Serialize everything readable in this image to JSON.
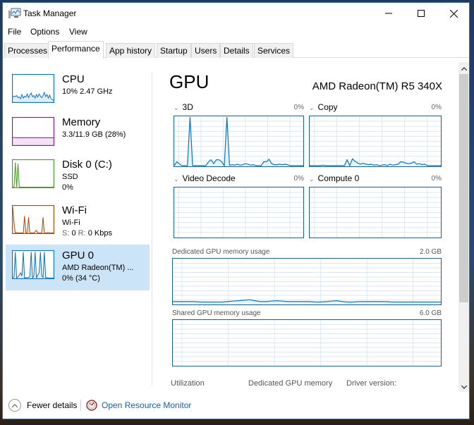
{
  "window": {
    "title": "Task Manager",
    "controls": {
      "minimize": "minimize-icon",
      "maximize": "maximize-icon",
      "close": "close-icon"
    }
  },
  "menu": [
    "File",
    "Options",
    "View"
  ],
  "tabs": [
    {
      "label": "Processes",
      "active": false
    },
    {
      "label": "Performance",
      "active": true
    },
    {
      "label": "App history",
      "active": false
    },
    {
      "label": "Startup",
      "active": false
    },
    {
      "label": "Users",
      "active": false
    },
    {
      "label": "Details",
      "active": false
    },
    {
      "label": "Services",
      "active": false
    }
  ],
  "sidebar": {
    "items": [
      {
        "title": "CPU",
        "line1": "10%  2.47 GHz",
        "line2": "",
        "color": "#1173bb",
        "selected": false,
        "series": [
          18,
          22,
          20,
          24,
          16,
          19,
          12,
          28,
          14,
          22,
          18,
          30,
          16,
          26,
          34,
          20,
          24,
          14,
          28,
          18,
          30,
          22,
          16,
          24,
          36,
          20,
          28,
          14,
          26,
          12,
          8,
          6
        ]
      },
      {
        "title": "Memory",
        "line1": "3.3/11.9 GB (28%)",
        "line2": "",
        "color": "#8b18a8",
        "selected": false,
        "series": [
          28,
          28,
          28,
          27,
          27,
          27,
          27,
          27,
          27,
          27,
          27,
          27,
          27,
          27,
          27,
          27,
          27,
          27,
          27,
          27,
          27,
          27,
          27,
          27,
          27,
          27,
          27,
          27,
          27,
          27,
          27,
          27
        ]
      },
      {
        "title": "Disk 0 (C:)",
        "line1": "SSD",
        "line2": "0%",
        "color": "#4f9a2a",
        "selected": false,
        "series": [
          0,
          0,
          95,
          0,
          90,
          0,
          0,
          0,
          0,
          0,
          0,
          0,
          0,
          0,
          0,
          0,
          0,
          0,
          0,
          0,
          0,
          0,
          0,
          0,
          0,
          0,
          0,
          0,
          0,
          0,
          0,
          2
        ]
      },
      {
        "title": "Wi-Fi",
        "line1": "Wi-Fi",
        "line2_s": "S:",
        "line2_s_val": "0",
        "line2_r": "R:",
        "line2_r_val": "0 Kbps",
        "color": "#a74f10",
        "selected": false,
        "series": [
          100,
          40,
          0,
          2,
          0,
          0,
          0,
          0,
          0,
          65,
          0,
          0,
          60,
          0,
          0,
          0,
          0,
          5,
          10,
          0,
          0,
          0,
          0,
          60,
          0,
          0,
          0,
          2,
          0,
          0,
          0,
          0
        ]
      },
      {
        "title": "GPU 0",
        "line1": "AMD Radeon(TM) ...",
        "line2": "0%  (34 °C)",
        "color": "#1173bb",
        "selected": true,
        "series": [
          0,
          5,
          100,
          0,
          5,
          12,
          20,
          8,
          100,
          0,
          2,
          2,
          2,
          5,
          100,
          0,
          8,
          100,
          0,
          12,
          20,
          100,
          8,
          2,
          100,
          0,
          2,
          0,
          0,
          0,
          0,
          0
        ]
      }
    ]
  },
  "main": {
    "title": "GPU",
    "device_name": "AMD Radeon(TM) R5 340X",
    "engines": [
      {
        "label": "3D",
        "percent": "0%",
        "series": [
          0,
          8,
          3,
          0,
          0,
          0,
          100,
          0,
          0,
          0,
          0,
          0,
          0,
          8,
          12,
          4,
          12,
          12,
          8,
          0,
          100,
          1,
          2,
          1,
          3,
          1,
          2,
          4,
          3,
          1,
          2,
          0,
          0,
          0,
          8,
          8,
          13,
          4,
          2,
          2,
          3,
          2,
          3,
          2,
          0,
          0,
          0,
          0,
          0,
          0
        ]
      },
      {
        "label": "Copy",
        "percent": "0%",
        "series": [
          0,
          0,
          0,
          0,
          0,
          1,
          0,
          0,
          0,
          0,
          0,
          0,
          0,
          0,
          12,
          0,
          14,
          9,
          5,
          3,
          5,
          3,
          2,
          3,
          1,
          2,
          0,
          1,
          2,
          0,
          3,
          1,
          2,
          3,
          8,
          7,
          5,
          4,
          5,
          8,
          3,
          4,
          2,
          3,
          0,
          0,
          0,
          0,
          0,
          0
        ]
      },
      {
        "label": "Video Decode",
        "percent": "0%",
        "series": []
      },
      {
        "label": "Compute 0",
        "percent": "0%",
        "series": []
      }
    ],
    "dedicated_memory": {
      "label": "Dedicated GPU memory usage",
      "max": "2.0 GB",
      "series": [
        5,
        5,
        5,
        5,
        5,
        4,
        4,
        4,
        4,
        4,
        5,
        6,
        7,
        8,
        9,
        7,
        5,
        5,
        6,
        7,
        6,
        5,
        5,
        5,
        5,
        5,
        4,
        4,
        5,
        6,
        7,
        5,
        4,
        4,
        5,
        5,
        5,
        5,
        5,
        5,
        4,
        4,
        4,
        4,
        4,
        4,
        4,
        4,
        4,
        4
      ]
    },
    "shared_memory": {
      "label": "Shared GPU memory usage",
      "max": "6.0 GB",
      "series": []
    },
    "stats": [
      "Utilization",
      "Dedicated GPU memory",
      "Driver version:"
    ]
  },
  "footer": {
    "fewer_details": "Fewer details",
    "resource_monitor": "Open Resource Monitor"
  },
  "colors": {
    "gpu_line": "#1173bb",
    "chart_border": "#17618f",
    "grid": "#d9e8f2",
    "selected_bg": "#cce4f7",
    "link": "#1a5ea8"
  }
}
